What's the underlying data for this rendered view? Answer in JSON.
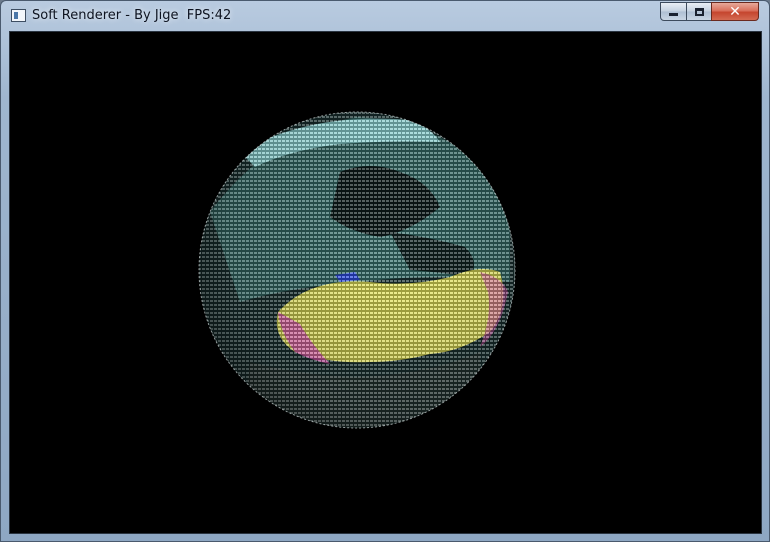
{
  "window": {
    "title": "Soft Renderer - By Jige  FPS:42",
    "controls": {
      "minimize_glyph": "minimize-icon",
      "maximize_glyph": "maximize-icon",
      "close_glyph": "✕"
    }
  },
  "scene": {
    "background_color": "#000000",
    "object": "textured-earth-sphere",
    "palette": {
      "ocean": "#2e5d5a",
      "ocean_light": "#4f8f8a",
      "land": "#ffff66",
      "land_edge": "#ff66cc",
      "ice": "#aaffff",
      "shadow": "#cfd8d8"
    }
  }
}
